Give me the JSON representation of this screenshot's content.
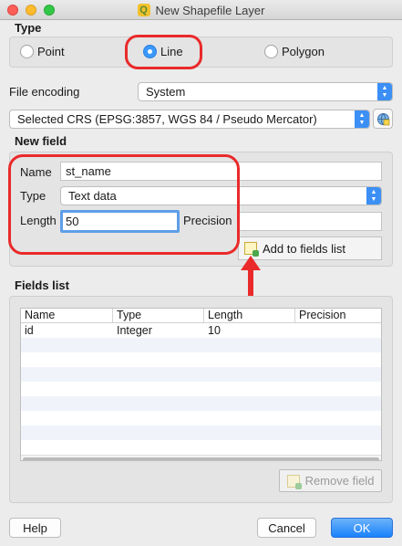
{
  "window": {
    "title": "New Shapefile Layer"
  },
  "type_group": {
    "label": "Type",
    "options": [
      {
        "label": "Point",
        "checked": false
      },
      {
        "label": "Line",
        "checked": true
      },
      {
        "label": "Polygon",
        "checked": false
      }
    ]
  },
  "file_encoding": {
    "label": "File encoding",
    "value": "System"
  },
  "crs": {
    "value": "Selected CRS (EPSG:3857, WGS 84 / Pseudo Mercator)"
  },
  "new_field": {
    "label": "New field",
    "name_label": "Name",
    "name_value": "st_name",
    "type_label": "Type",
    "type_value": "Text data",
    "length_label": "Length",
    "length_value": "50",
    "precision_label": "Precision",
    "precision_value": "",
    "add_button": "Add to fields list"
  },
  "fields_list": {
    "label": "Fields list",
    "columns": [
      "Name",
      "Type",
      "Length",
      "Precision"
    ],
    "rows": [
      [
        "id",
        "Integer",
        "10",
        ""
      ]
    ],
    "remove_button": "Remove field"
  },
  "footer": {
    "help": "Help",
    "cancel": "Cancel",
    "ok": "OK"
  },
  "colors": {
    "accent": "#3b8ff5",
    "highlight": "#ea2a2a"
  }
}
